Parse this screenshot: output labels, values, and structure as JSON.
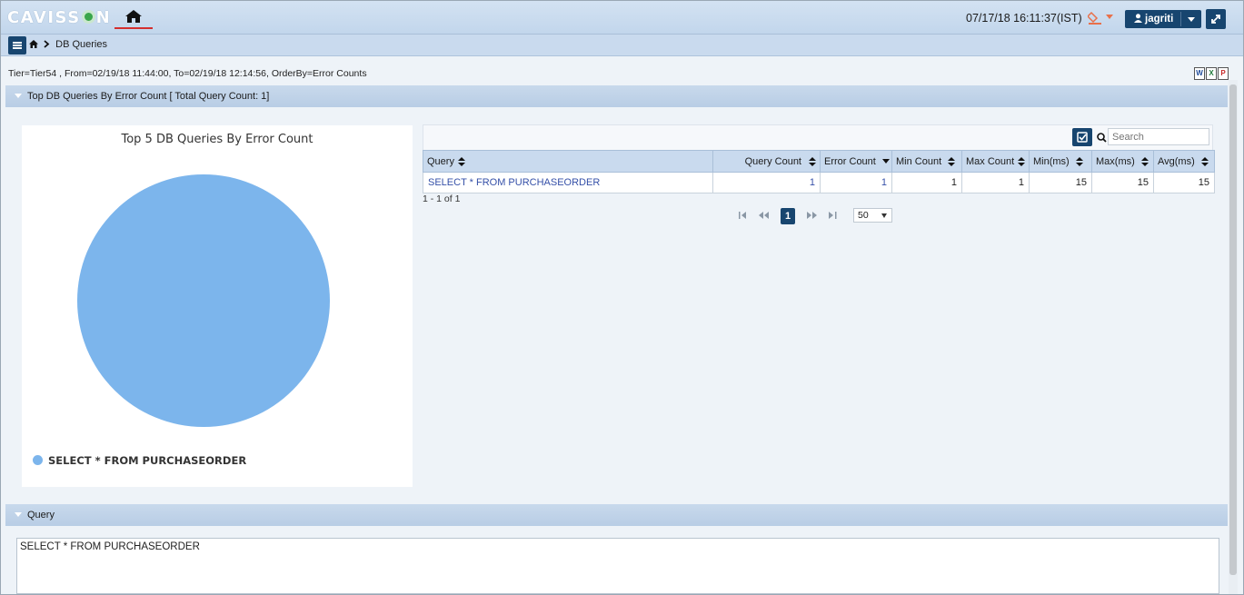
{
  "header": {
    "logo_pre": "CAVISS",
    "logo_post": "N",
    "datetime": "07/17/18 16:11:37(IST)",
    "user": "jagriti",
    "icons": [
      "home-icon",
      "bell-icon",
      "user-icon",
      "expand-icon"
    ]
  },
  "breadcrumb": {
    "page": "DB Queries"
  },
  "filter": {
    "text": "Tier=Tier54 , From=02/19/18 11:44:00, To=02/19/18 12:14:56, OrderBy=Error Counts"
  },
  "panels": {
    "top_title": "Top DB Queries By Error Count [ Total Query Count: 1]",
    "query_title": "Query"
  },
  "chart_data": {
    "type": "pie",
    "title": "Top 5 DB Queries By Error Count",
    "categories": [
      "SELECT * FROM PURCHASEORDER"
    ],
    "values": [
      1
    ],
    "colors": [
      "#7cb5ec"
    ],
    "legend": "bottom-left"
  },
  "table": {
    "search_placeholder": "Search",
    "columns": [
      "Query",
      "Query Count",
      "Error Count",
      "Min Count",
      "Max Count",
      "Min(ms)",
      "Max(ms)",
      "Avg(ms)"
    ],
    "rows": [
      [
        "SELECT * FROM PURCHASEORDER",
        "1",
        "1",
        "1",
        "1",
        "15",
        "15",
        "15"
      ]
    ],
    "pager_info": "1 - 1 of 1",
    "current_page": "1",
    "rows_per_page": "50"
  },
  "query_text": "SELECT * FROM PURCHASEORDER"
}
